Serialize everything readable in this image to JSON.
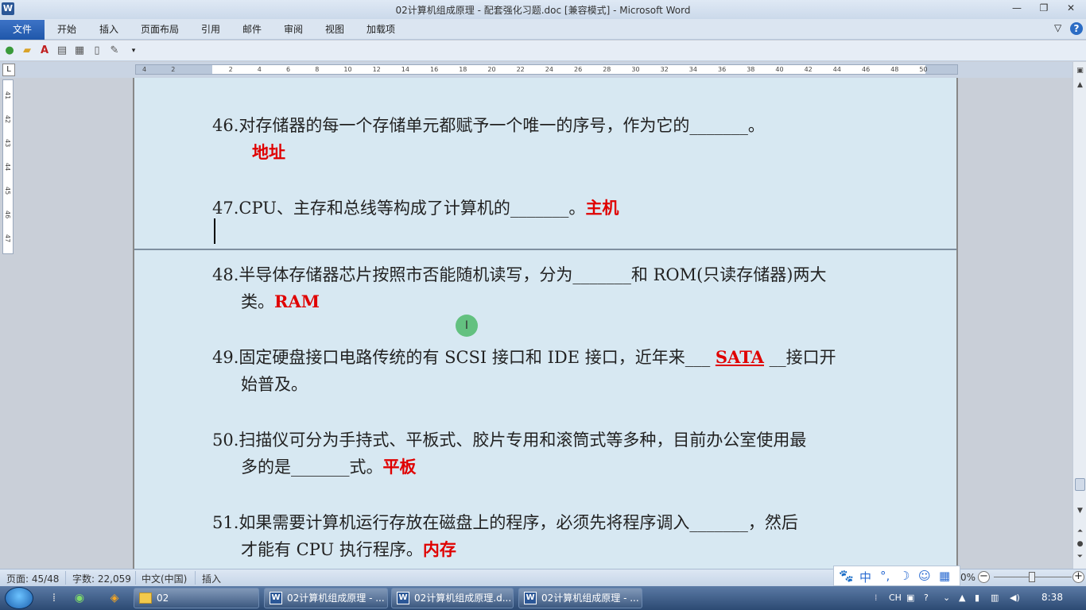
{
  "window": {
    "title": "02计算机组成原理 - 配套强化习题.doc [兼容模式] - Microsoft Word",
    "app_icon": "W"
  },
  "ribbon": {
    "file_tab": "文件",
    "tabs": [
      "开始",
      "插入",
      "页面布局",
      "引用",
      "邮件",
      "审阅",
      "视图",
      "加载项"
    ]
  },
  "ruler": {
    "corner": "L",
    "numbers": [
      "4",
      "2",
      "",
      "2",
      "4",
      "6",
      "8",
      "10",
      "12",
      "14",
      "16",
      "18",
      "20",
      "22",
      "24",
      "26",
      "28",
      "30",
      "32",
      "34",
      "36",
      "38",
      "40",
      "42",
      "44",
      "46",
      "48",
      "50"
    ],
    "vnumbers": [
      "41",
      "42",
      "43",
      "44",
      "45",
      "46",
      "47"
    ]
  },
  "document": {
    "q46": {
      "num": "46.",
      "text": "对存储器的每一个存储单元都赋予一个唯一的序号，作为它的_______。",
      "answer": "地址"
    },
    "q47": {
      "num": "47.",
      "text": "CPU、主存和总线等构成了计算机的_______。",
      "answer": "主机"
    },
    "q48": {
      "num": "48.",
      "text1": "半导体存储器芯片按照市否能随机读写，分为_______和 ROM(只读存储器)两大",
      "text2": "类。",
      "answer": "RAM"
    },
    "q49": {
      "num": "49.",
      "text1a": "固定硬盘接口电路传统的有 SCSI 接口和 IDE 接口，近年来___ ",
      "answer": "SATA",
      "text1b": " __接口开",
      "text2": "始普及。"
    },
    "q50": {
      "num": "50.",
      "text1": "扫描仪可分为手持式、平板式、胶片专用和滚筒式等多种，目前办公室使用最",
      "text2": "多的是_______式。",
      "answer": "平板"
    },
    "q51": {
      "num": "51.",
      "text1": "如果需要计算机运行存放在磁盘上的程序，必须先将程序调入_______，然后",
      "text2": "才能有 CPU 执行程序。",
      "answer": "内存"
    },
    "cursor_glyph": "I"
  },
  "statusbar": {
    "page": "页面: 45/48",
    "words": "字数: 22,059",
    "language": "中文(中国)",
    "mode": "插入",
    "zoom_suffix": "0%",
    "ime": [
      "中",
      "°,",
      "☽"
    ]
  },
  "taskbar": {
    "buttons": [
      "02",
      "02计算机组成原理 - ...",
      "02计算机组成原理.d...",
      "02计算机组成原理 - ..."
    ],
    "tray_lang": "CH",
    "time": "8:38"
  }
}
